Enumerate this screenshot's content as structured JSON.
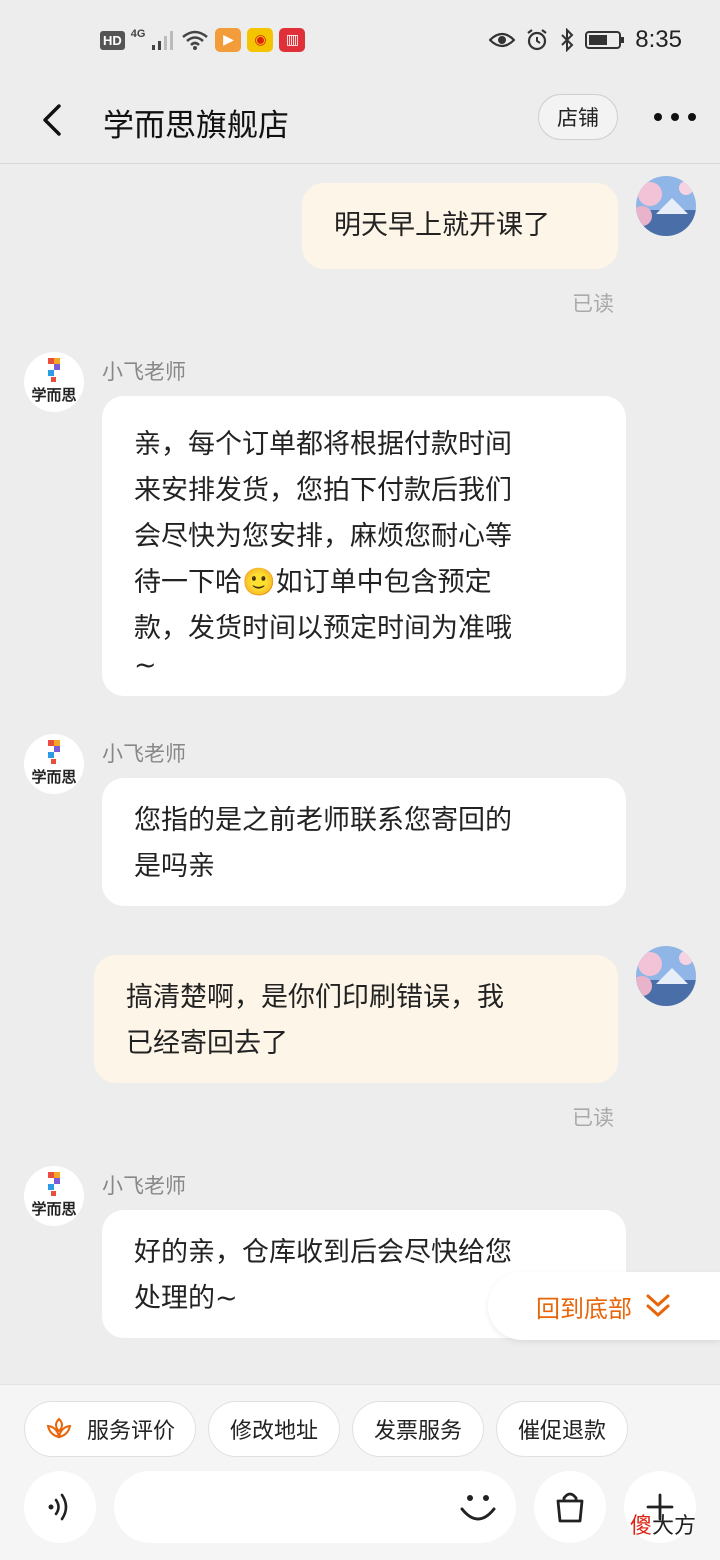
{
  "status_bar": {
    "hd": "HD",
    "network": "4G",
    "time": "8:35",
    "colors": {
      "video_app": "#f39c3a",
      "weibo_app": "#f5c400",
      "book_app": "#e0303a"
    }
  },
  "nav": {
    "title": "学而思旗舰店",
    "store_button": "店铺"
  },
  "store_avatar_text": "学而思",
  "messages": [
    {
      "direction": "out",
      "text": "明天早上就开课了",
      "read": "已读"
    },
    {
      "direction": "in",
      "sender": "小飞老师",
      "lines": [
        "亲，每个订单都将根据付款时间",
        "来安排发货，您拍下付款后我们",
        "会尽快为您安排，麻烦您耐心等"
      ],
      "line4_before": "待一下哈",
      "emoji": "🙂",
      "line4_after": "如订单中包含预定",
      "lines_after": [
        "款，发货时间以预定时间为准哦",
        "~"
      ]
    },
    {
      "direction": "in",
      "sender": "小飞老师",
      "lines": [
        "您指的是之前老师联系您寄回的",
        "是吗亲"
      ]
    },
    {
      "direction": "out",
      "lines": [
        "搞清楚啊，是你们印刷错误，我",
        "已经寄回去了"
      ],
      "read": "已读"
    },
    {
      "direction": "in",
      "sender": "小飞老师",
      "lines": [
        "好的亲，仓库收到后会尽快给您",
        "处理的~"
      ]
    }
  ],
  "back_to_bottom": "回到底部",
  "quick_actions": [
    "服务评价",
    "修改地址",
    "发票服务",
    "催促退款"
  ],
  "input": {
    "placeholder": "",
    "value": ""
  },
  "watermark": {
    "red": "傻",
    "black": "大方"
  },
  "accent_color": "#e8650a"
}
